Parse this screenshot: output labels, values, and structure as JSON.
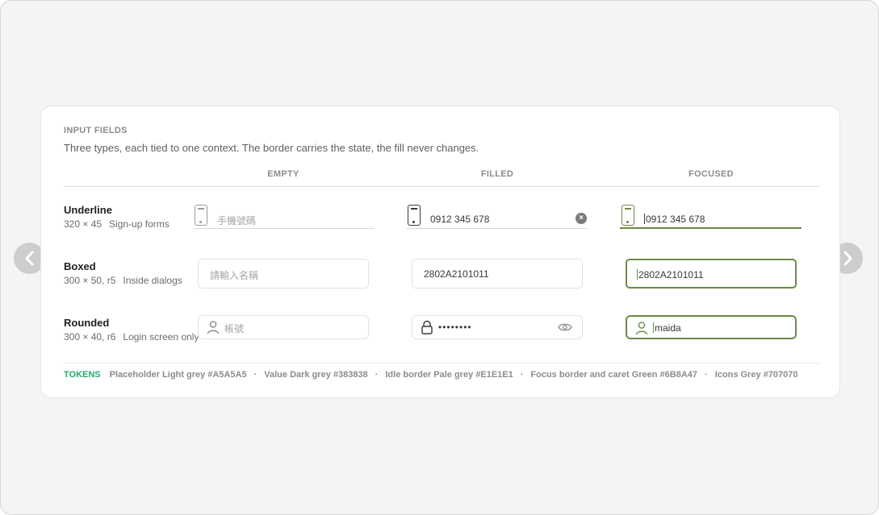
{
  "section": {
    "title": "INPUT FIELDS",
    "description": "Three types, each tied to one context. The border carries the state, the fill never changes."
  },
  "columns": [
    "EMPTY",
    "FILLED",
    "FOCUSED"
  ],
  "rows": [
    {
      "name": "Underline",
      "size": "320 × 45",
      "context": "Sign-up forms",
      "empty": {
        "placeholder": "手機號碼",
        "icon": "phone-icon"
      },
      "filled": {
        "value": "0912 345 678",
        "icon": "phone-icon",
        "trailing_icon": "clear-icon"
      },
      "focused": {
        "value": "0912 345 678",
        "icon": "phone-icon"
      }
    },
    {
      "name": "Boxed",
      "size": "300 × 50, r5",
      "context": "Inside dialogs",
      "empty": {
        "placeholder": "請輸入名稱"
      },
      "filled": {
        "value": "2802A2101011"
      },
      "focused": {
        "value": "2802A2101011"
      }
    },
    {
      "name": "Rounded",
      "size": "300 × 40, r6",
      "context": "Login screen only",
      "empty": {
        "placeholder": "帳號",
        "icon": "user-icon"
      },
      "filled": {
        "value": "••••••••",
        "icon": "lock-icon",
        "trailing_icon": "eye-icon"
      },
      "focused": {
        "value": "maida",
        "icon": "user-icon"
      }
    }
  ],
  "tokens": {
    "label": "TOKENS",
    "items": [
      "Placeholder Light grey #A5A5A5",
      "Value Dark grey #383838",
      "Idle border Pale grey #E1E1E1",
      "Focus border and caret Green #6B8A47",
      "Icons Grey #707070"
    ],
    "separator": "·"
  },
  "colors": {
    "placeholder": "#A5A5A5",
    "value": "#383838",
    "idle_border": "#E1E1E1",
    "focus": "#6B8A47",
    "icons": "#707070",
    "tokens_label": "#2AA86A"
  },
  "nav": {
    "prev_icon": "chevron-left-icon",
    "next_icon": "chevron-right-icon"
  }
}
